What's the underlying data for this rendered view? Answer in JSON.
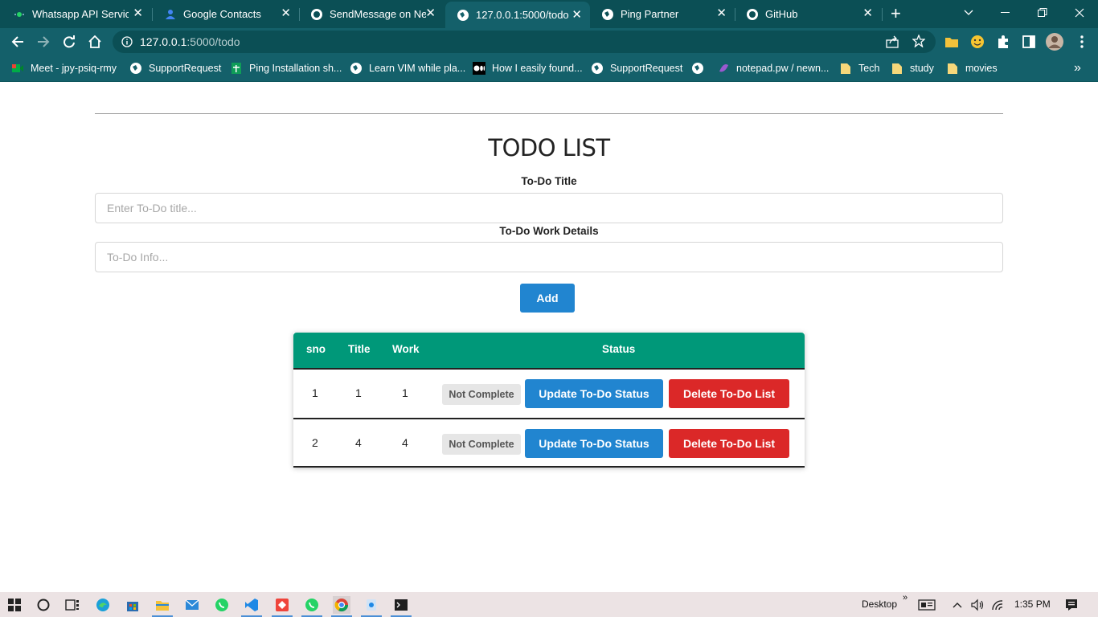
{
  "browser": {
    "tabs": [
      {
        "title": "Whatsapp API Service",
        "icon": "whatsapp-dot-icon",
        "active": false
      },
      {
        "title": "Google Contacts",
        "icon": "google-contacts-icon",
        "active": false
      },
      {
        "title": "SendMessage on New",
        "icon": "github-icon",
        "active": false
      },
      {
        "title": "127.0.0.1:5000/todo",
        "icon": "globe-icon",
        "active": true
      },
      {
        "title": "Ping Partner",
        "icon": "globe-icon",
        "active": false
      },
      {
        "title": "GitHub",
        "icon": "github-icon",
        "active": false
      }
    ],
    "new_tab": "+",
    "address": {
      "host": "127.0.0.1",
      "path": ":5000/todo"
    },
    "bookmarks": [
      {
        "label": "Meet - jpy-psiq-rmy",
        "icon": "meet-icon"
      },
      {
        "label": "SupportRequest",
        "icon": "globe-icon"
      },
      {
        "label": "Ping Installation sh...",
        "icon": "sheets-icon"
      },
      {
        "label": "Learn VIM while pla...",
        "icon": "globe-icon"
      },
      {
        "label": "How I easily found...",
        "icon": "medium-icon"
      },
      {
        "label": "SupportRequest",
        "icon": "globe-icon"
      },
      {
        "label": "",
        "icon": "globe-icon"
      },
      {
        "label": "notepad.pw / newn...",
        "icon": "notepad-icon"
      },
      {
        "label": "Tech",
        "icon": "folder-icon"
      },
      {
        "label": "study",
        "icon": "folder-icon"
      },
      {
        "label": "movies",
        "icon": "folder-icon"
      }
    ],
    "bookmarks_more": "»"
  },
  "page": {
    "heading": "TODO LIST",
    "title_label": "To-Do Title",
    "title_placeholder": "Enter To-Do title...",
    "title_value": "",
    "work_label": "To-Do Work Details",
    "work_placeholder": "To-Do Info...",
    "work_value": "",
    "add_label": "Add",
    "table": {
      "headers": [
        "sno",
        "Title",
        "Work",
        "Status"
      ],
      "rows": [
        {
          "sno": "1",
          "title": "1",
          "work": "1",
          "status": "Not Complete",
          "update": "Update To-Do Status",
          "delete": "Delete To-Do List"
        },
        {
          "sno": "2",
          "title": "4",
          "work": "4",
          "status": "Not Complete",
          "update": "Update To-Do Status",
          "delete": "Delete To-Do List"
        }
      ]
    }
  },
  "taskbar": {
    "desktop_label": "Desktop",
    "chevron": "»",
    "time": "1:35 PM"
  },
  "colors": {
    "chrome_frame": "#0b4f55",
    "chrome_toolbar": "#14606a",
    "table_header": "#009879",
    "primary_button": "#2185d0",
    "danger_button": "#db2828",
    "taskbar": "#ece3e4"
  }
}
